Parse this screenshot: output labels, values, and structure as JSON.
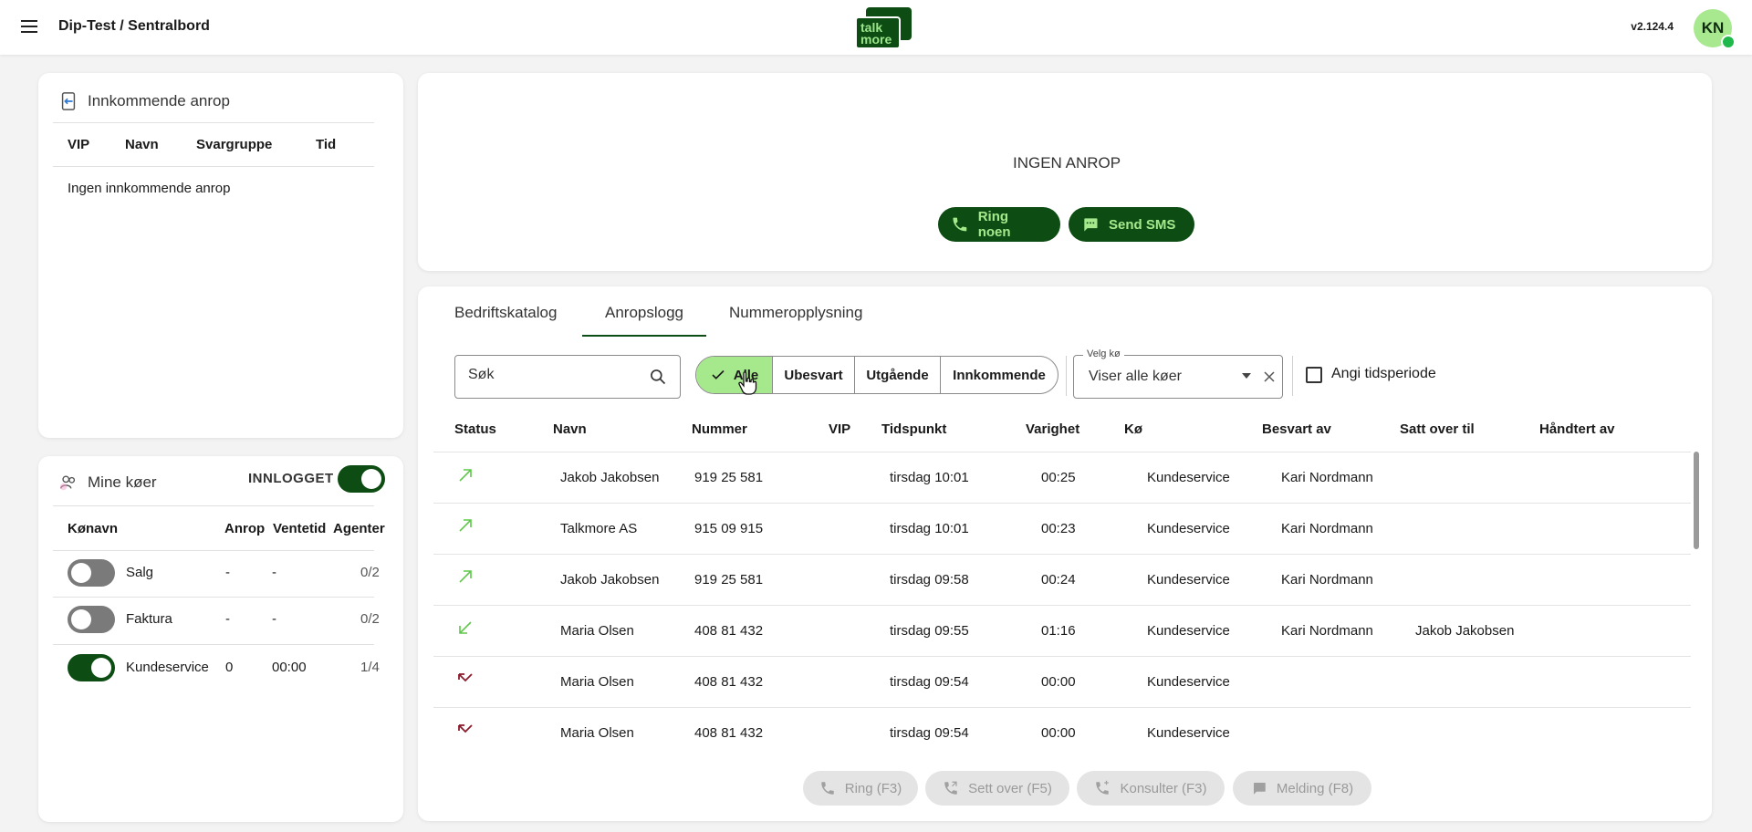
{
  "header": {
    "title": "Dip-Test / Sentralbord",
    "logo_text": [
      "talk",
      "more"
    ],
    "version": "v2.124.4",
    "avatar_initials": "KN"
  },
  "incoming": {
    "title": "Innkommende anrop",
    "columns": [
      "VIP",
      "Navn",
      "Svargruppe",
      "Tid"
    ],
    "empty_text": "Ingen innkommende anrop"
  },
  "queues": {
    "title": "Mine køer",
    "status_label": "INNLOGGET",
    "columns": [
      "Kønavn",
      "Anrop",
      "Ventetid",
      "Agenter"
    ],
    "rows": [
      {
        "name": "Salg",
        "calls": "-",
        "wait": "-",
        "agents": "0/2",
        "on": false
      },
      {
        "name": "Faktura",
        "calls": "-",
        "wait": "-",
        "agents": "0/2",
        "on": false
      },
      {
        "name": "Kundeservice",
        "calls": "0",
        "wait": "00:00",
        "agents": "1/4",
        "on": true
      }
    ]
  },
  "call_panel": {
    "status": "INGEN ANROP",
    "call_button": "Ring noen",
    "sms_button": "Send SMS"
  },
  "tabs": [
    "Bedriftskatalog",
    "Anropslogg",
    "Nummeropplysning"
  ],
  "active_tab": 1,
  "search": {
    "placeholder": "Søk"
  },
  "filters": [
    "Alle",
    "Ubesvart",
    "Utgående",
    "Innkommende"
  ],
  "active_filter": 0,
  "queue_select": {
    "label": "Velg kø",
    "value": "Viser alle køer"
  },
  "period_label": "Angi tidsperiode",
  "log": {
    "columns": [
      "Status",
      "Navn",
      "Nummer",
      "VIP",
      "Tidspunkt",
      "Varighet",
      "Kø",
      "Besvart av",
      "Satt over til",
      "Håndtert av"
    ],
    "rows": [
      {
        "status": "outgoing",
        "name": "Jakob Jakobsen",
        "number": "919 25 581",
        "vip": "",
        "time": "tirsdag 10:01",
        "duration": "00:25",
        "queue": "Kundeservice",
        "answered_by": "Kari Nordmann",
        "transferred_to": "",
        "handled_by": ""
      },
      {
        "status": "outgoing",
        "name": "Talkmore AS",
        "number": "915 09 915",
        "vip": "",
        "time": "tirsdag 10:01",
        "duration": "00:23",
        "queue": "Kundeservice",
        "answered_by": "Kari Nordmann",
        "transferred_to": "",
        "handled_by": ""
      },
      {
        "status": "outgoing",
        "name": "Jakob Jakobsen",
        "number": "919 25 581",
        "vip": "",
        "time": "tirsdag 09:58",
        "duration": "00:24",
        "queue": "Kundeservice",
        "answered_by": "Kari Nordmann",
        "transferred_to": "",
        "handled_by": ""
      },
      {
        "status": "incoming",
        "name": "Maria Olsen",
        "number": "408 81 432",
        "vip": "",
        "time": "tirsdag 09:55",
        "duration": "01:16",
        "queue": "Kundeservice",
        "answered_by": "Kari Nordmann",
        "transferred_to": "Jakob Jakobsen",
        "handled_by": ""
      },
      {
        "status": "missed",
        "name": "Maria Olsen",
        "number": "408 81 432",
        "vip": "",
        "time": "tirsdag 09:54",
        "duration": "00:00",
        "queue": "Kundeservice",
        "answered_by": "",
        "transferred_to": "",
        "handled_by": ""
      },
      {
        "status": "missed",
        "name": "Maria Olsen",
        "number": "408 81 432",
        "vip": "",
        "time": "tirsdag 09:54",
        "duration": "00:00",
        "queue": "Kundeservice",
        "answered_by": "",
        "transferred_to": "",
        "handled_by": ""
      }
    ]
  },
  "actions": [
    {
      "label": "Ring (F3)",
      "icon": "phone-icon"
    },
    {
      "label": "Sett over (F5)",
      "icon": "transfer-icon"
    },
    {
      "label": "Konsulter (F3)",
      "icon": "consult-icon"
    },
    {
      "label": "Melding (F8)",
      "icon": "message-icon"
    }
  ],
  "colors": {
    "brand_dark": "#0d4d14",
    "brand_light": "#a6e98c",
    "outgoing_arrow": "#5fc74a",
    "missed_arrow": "#8b1a2b",
    "disabled_bg": "#e4e4e4"
  }
}
